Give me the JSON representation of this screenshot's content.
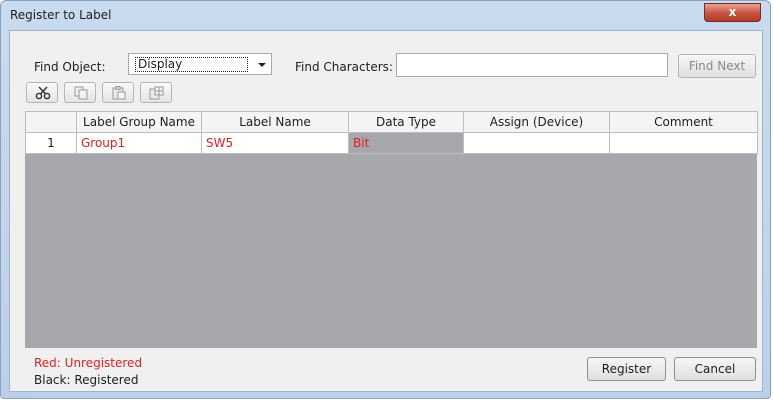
{
  "window": {
    "title": "Register to Label",
    "close_label": "x"
  },
  "search": {
    "find_object_label": "Find Object:",
    "find_object_value": "Display",
    "find_characters_label": "Find Characters:",
    "find_characters_value": "",
    "find_next_label": "Find Next"
  },
  "toolbar": {
    "items": [
      "scissors-icon",
      "copy-icon",
      "paste-icon",
      "grid-paste-icon"
    ]
  },
  "table": {
    "headers": [
      "",
      "Label Group Name",
      "Label Name",
      "Data Type",
      "Assign (Device)",
      "Comment"
    ],
    "rows": [
      {
        "num": "1",
        "group": "Group1",
        "label": "SW5",
        "type": "Bit",
        "assign": "",
        "comment": ""
      }
    ]
  },
  "legend": {
    "red": "Red: Unregistered",
    "black": "Black: Registered"
  },
  "buttons": {
    "register": "Register",
    "cancel": "Cancel"
  },
  "colors": {
    "unregistered": "#e02020",
    "grid_empty": "#a7a8ab",
    "title_bar": "#c9dbef"
  }
}
